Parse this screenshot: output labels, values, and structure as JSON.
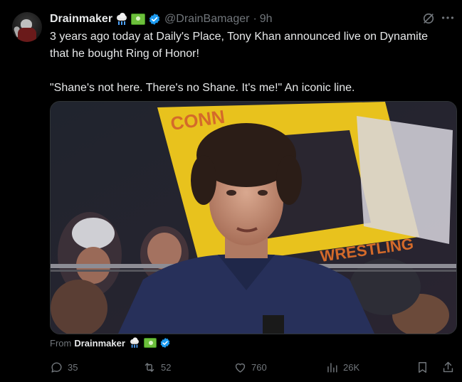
{
  "post": {
    "author_name": "Drainmaker",
    "handle": "@DrainBamager",
    "separator": "·",
    "time": "9h",
    "text": "3 years ago today at Daily's Place, Tony Khan announced live on Dynamite\nthat he bought Ring of Honor!\n\n\"Shane's not here. There's no Shane. It's me!\" An iconic line.",
    "name_icons": [
      "cloud-with-rain-icon",
      "money-icon",
      "verified-icon"
    ]
  },
  "media": {
    "sign_top_text": "CONN",
    "sign_bottom_text": "WRESTLING"
  },
  "from": {
    "prefix": "From",
    "author_name": "Drainmaker"
  },
  "actions": {
    "replies": "35",
    "reposts": "52",
    "likes": "760",
    "views": "26K"
  },
  "colors": {
    "background": "#000000",
    "text": "#e7e9ea",
    "muted": "#71767b",
    "verified": "#1d9bf0",
    "sign_yellow": "#e8c21d"
  }
}
